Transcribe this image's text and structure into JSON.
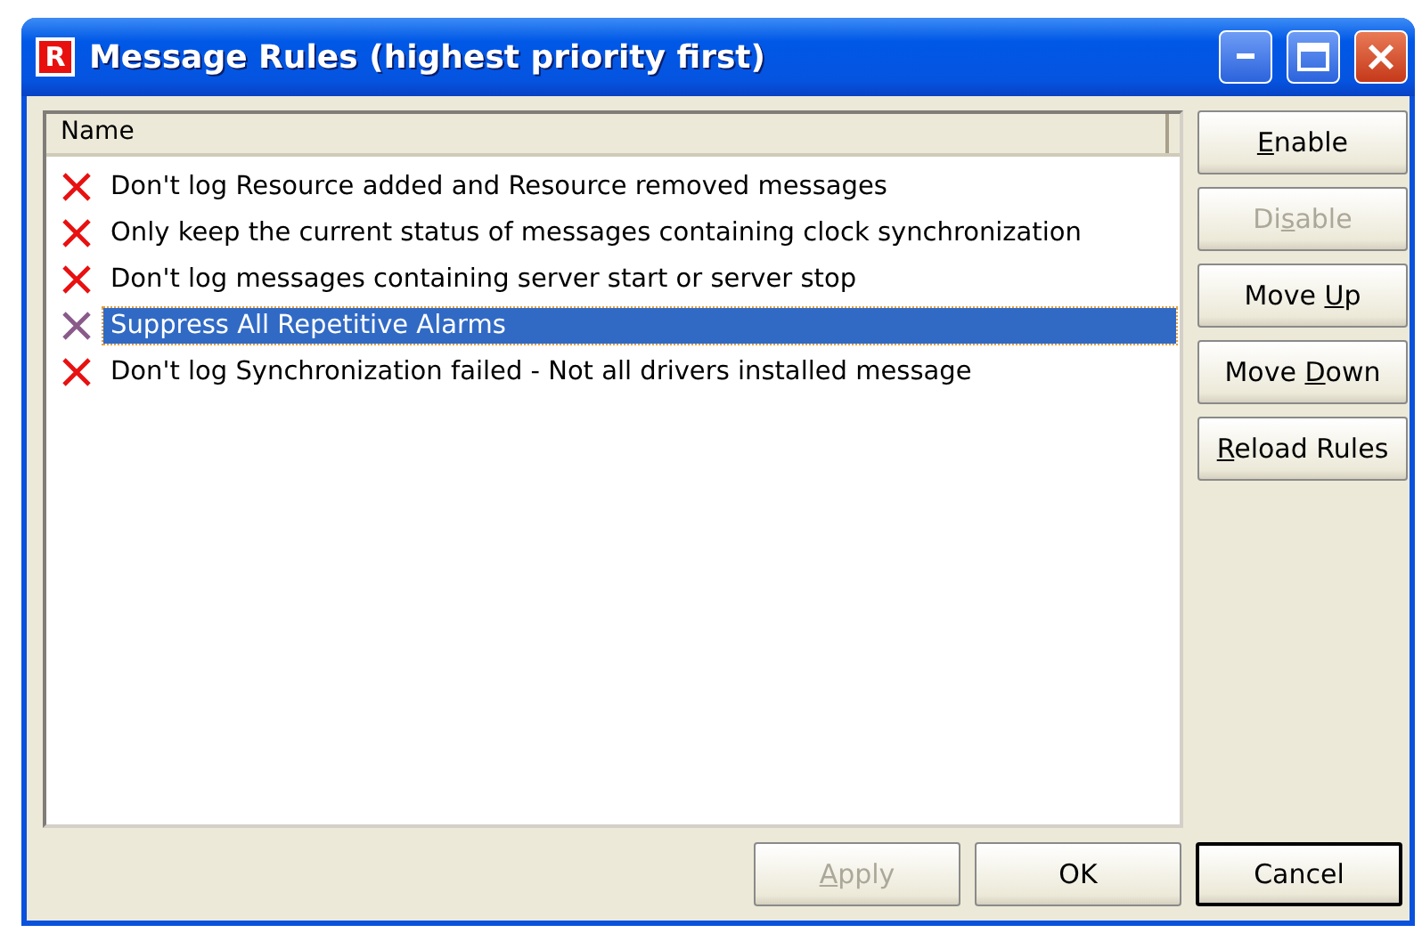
{
  "window": {
    "title": "Message Rules (highest priority first)",
    "app_icon": "R"
  },
  "list": {
    "column": "Name",
    "rows": [
      {
        "label": "Don't log Resource added and Resource removed messages",
        "selected": false
      },
      {
        "label": "Only keep the current status of messages containing clock synchronization",
        "selected": false
      },
      {
        "label": "Don't log messages containing server start or server stop",
        "selected": false
      },
      {
        "label": "Suppress All Repetitive Alarms",
        "selected": true
      },
      {
        "label": "Don't log Synchronization failed - Not all drivers installed message",
        "selected": false
      }
    ]
  },
  "side_buttons": [
    {
      "key": "E",
      "post": "nable",
      "disabled": false
    },
    {
      "pre": "Di",
      "key": "s",
      "post": "able",
      "disabled": true
    },
    {
      "pre": "Move ",
      "key": "U",
      "post": "p",
      "disabled": false
    },
    {
      "pre": "Move ",
      "key": "D",
      "post": "own",
      "disabled": false
    },
    {
      "key": "R",
      "post": "eload Rules",
      "disabled": false
    }
  ],
  "bottom_buttons": [
    {
      "key": "A",
      "post": "pply",
      "disabled": true,
      "default": false
    },
    {
      "pre": "OK",
      "disabled": false,
      "default": false
    },
    {
      "pre": "Cancel",
      "disabled": false,
      "default": true
    }
  ]
}
